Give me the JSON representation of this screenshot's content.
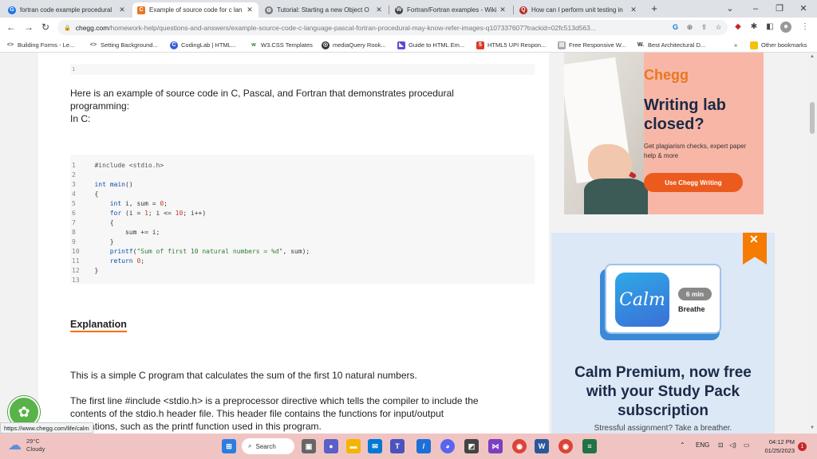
{
  "browser": {
    "tabs": [
      {
        "title": "fortran code example procedural",
        "favicon": "google-icon",
        "color": "#1a73e8",
        "glyph": "G"
      },
      {
        "title": "Example of source code for c lan",
        "favicon": "chegg-icon",
        "color": "#e87722",
        "glyph": "C"
      },
      {
        "title": "Tutorial: Starting a new Object O",
        "favicon": "tutorial-icon",
        "color": "#555555",
        "glyph": "⚙"
      },
      {
        "title": "Fortran/Fortran examples - Wiki",
        "favicon": "wikibooks-icon",
        "color": "#333333",
        "glyph": "W"
      },
      {
        "title": "How can I perform unit testing in",
        "favicon": "quora-icon",
        "color": "#b92b27",
        "glyph": "Q"
      }
    ],
    "new_tab": "+",
    "window_controls": {
      "minimize": "–",
      "restore": "❐",
      "close": "✕",
      "tab_search": "⌄"
    },
    "url_host": "chegg.com",
    "url_path": "/homework-help/questions-and-answers/example-source-code-c-language-pascal-fortran-procedural-may-know-refer-images-q107337607?trackid=02fc513d563...",
    "bookmarks": [
      {
        "label": "Building Forms - Le...",
        "icon": "code-icon"
      },
      {
        "label": "Setting Background...",
        "icon": "code-icon"
      },
      {
        "label": "CodingLab | HTML...",
        "icon": "codinglab-icon"
      },
      {
        "label": "W3.CSS Templates",
        "icon": "w3-icon"
      },
      {
        "label": "mediaQuery Rook...",
        "icon": "globe-icon"
      },
      {
        "label": "Guide to HTML Em...",
        "icon": "guide-icon"
      },
      {
        "label": "HTML5 UPI Respon...",
        "icon": "html5-icon"
      },
      {
        "label": "Free Responsive W...",
        "icon": "page-icon"
      },
      {
        "label": "Best Architectural D...",
        "icon": "w-icon"
      }
    ],
    "bookmarks_more": "»",
    "other_bookmarks": "Other bookmarks"
  },
  "article": {
    "top_line_no": "1",
    "intro_lines": [
      "Here is an example of source code in C, Pascal, and Fortran that demonstrates procedural",
      "programming:",
      "In C:"
    ],
    "code_lines": [
      {
        "n": "1",
        "t": "#include <stdio.h>"
      },
      {
        "n": "2",
        "t": ""
      },
      {
        "n": "3",
        "t": "int main()"
      },
      {
        "n": "4",
        "t": "{"
      },
      {
        "n": "5",
        "t": "    int i, sum = 0;"
      },
      {
        "n": "6",
        "t": "    for (i = 1; i <= 10; i++)"
      },
      {
        "n": "7",
        "t": "    {"
      },
      {
        "n": "8",
        "t": "        sum += i;"
      },
      {
        "n": "9",
        "t": "    }"
      },
      {
        "n": "10",
        "t": "    printf(\"Sum of first 10 natural numbers = %d\", sum);"
      },
      {
        "n": "11",
        "t": "    return 0;"
      },
      {
        "n": "12",
        "t": "}"
      },
      {
        "n": "13",
        "t": ""
      }
    ],
    "explanation_heading": "Explanation",
    "summary": "This is a simple C program that calculates the sum of the first 10 natural numbers.",
    "detail_lines": [
      "The first line #include <stdio.h> is a preprocessor directive which tells the compiler to include the",
      "contents of the stdio.h header file. This header file contains the functions for input/output",
      "operations, such as the printf function used in this program."
    ]
  },
  "ads": {
    "chegg": {
      "logo": "Chegg",
      "headline": "Writing lab closed?",
      "sub": "Get plagiarism checks, expert paper help & more",
      "cta": "Use Chegg Writing"
    },
    "calm": {
      "logo": "Calm",
      "duration": "6 min",
      "activity": "Breathe",
      "headline": "Calm Premium, now free with your Study Pack subscription",
      "sub": "Stressful assignment? Take a breather."
    }
  },
  "status_url": "https://www.chegg.com/life/calm",
  "taskbar": {
    "weather_temp": "29°C",
    "weather_desc": "Cloudy",
    "search_label": "Search",
    "lang": "ENG",
    "time": "04:12 PM",
    "date": "01/25/2023",
    "notif_count": "1"
  }
}
